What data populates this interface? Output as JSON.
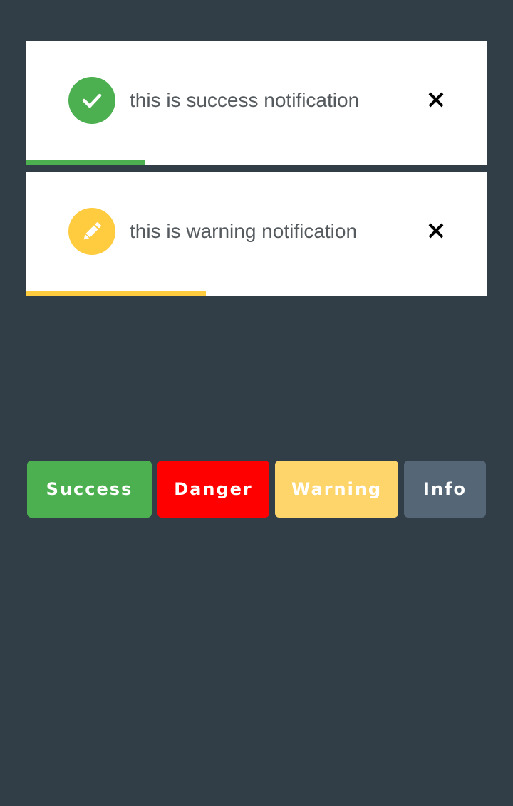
{
  "colors": {
    "background": "#313d47",
    "success": "#4caf50",
    "danger": "#ff0000",
    "warning": "#ffcb3f",
    "warning_button": "#fdd56b",
    "info": "#556677",
    "toast_background": "#ffffff"
  },
  "notifications": [
    {
      "type": "success",
      "icon": "check-icon",
      "message": "this is success notification",
      "close_icon": "close-icon",
      "progress": 0.26
    },
    {
      "type": "warning",
      "icon": "pencil-icon",
      "message": "this is warning notification",
      "close_icon": "close-icon",
      "progress": 0.39
    }
  ],
  "buttons": [
    {
      "label": "Success"
    },
    {
      "label": "Danger"
    },
    {
      "label": "Warning"
    },
    {
      "label": "Info"
    }
  ]
}
